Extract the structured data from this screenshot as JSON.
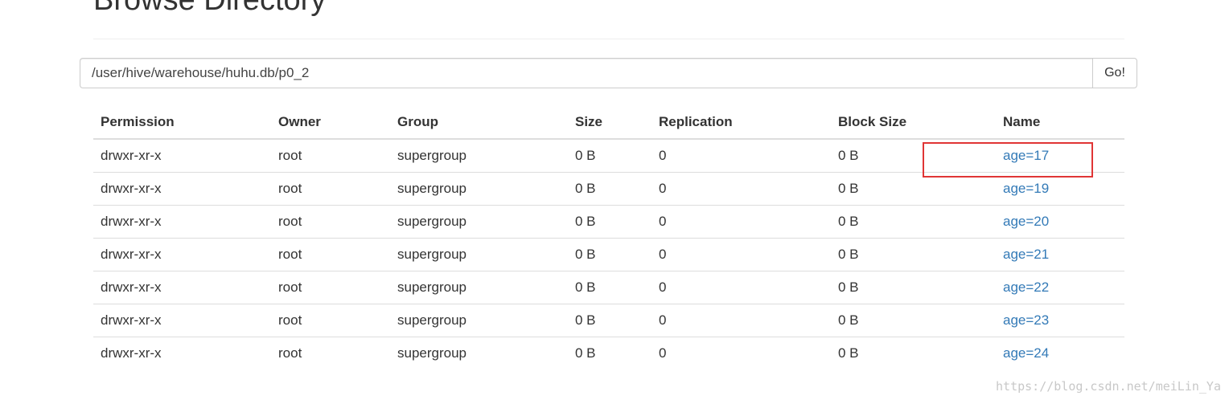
{
  "page": {
    "title": "Browse Directory"
  },
  "path_form": {
    "path_value": "/user/hive/warehouse/huhu.db/p0_2",
    "go_label": "Go!"
  },
  "table": {
    "headers": {
      "permission": "Permission",
      "owner": "Owner",
      "group": "Group",
      "size": "Size",
      "replication": "Replication",
      "block_size": "Block Size",
      "name": "Name"
    },
    "rows": [
      {
        "permission": "drwxr-xr-x",
        "owner": "root",
        "group": "supergroup",
        "size": "0 B",
        "replication": "0",
        "block_size": "0 B",
        "name": "age=17"
      },
      {
        "permission": "drwxr-xr-x",
        "owner": "root",
        "group": "supergroup",
        "size": "0 B",
        "replication": "0",
        "block_size": "0 B",
        "name": "age=19"
      },
      {
        "permission": "drwxr-xr-x",
        "owner": "root",
        "group": "supergroup",
        "size": "0 B",
        "replication": "0",
        "block_size": "0 B",
        "name": "age=20"
      },
      {
        "permission": "drwxr-xr-x",
        "owner": "root",
        "group": "supergroup",
        "size": "0 B",
        "replication": "0",
        "block_size": "0 B",
        "name": "age=21"
      },
      {
        "permission": "drwxr-xr-x",
        "owner": "root",
        "group": "supergroup",
        "size": "0 B",
        "replication": "0",
        "block_size": "0 B",
        "name": "age=22"
      },
      {
        "permission": "drwxr-xr-x",
        "owner": "root",
        "group": "supergroup",
        "size": "0 B",
        "replication": "0",
        "block_size": "0 B",
        "name": "age=23"
      },
      {
        "permission": "drwxr-xr-x",
        "owner": "root",
        "group": "supergroup",
        "size": "0 B",
        "replication": "0",
        "block_size": "0 B",
        "name": "age=24"
      }
    ]
  },
  "colors": {
    "link": "#337ab7",
    "highlight": "#e03535",
    "text": "#333333"
  },
  "watermark": {
    "text": "https://blog.csdn.net/meiLin_Ya"
  }
}
